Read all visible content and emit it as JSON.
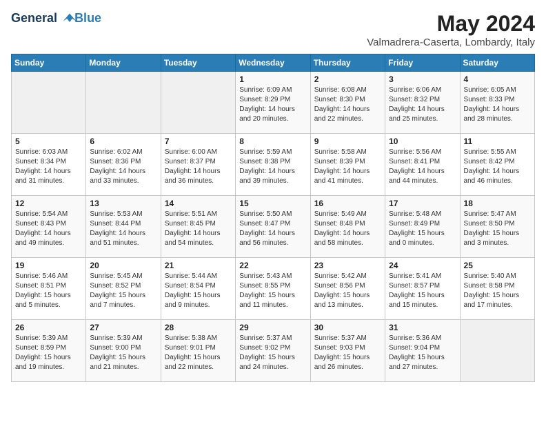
{
  "logo": {
    "line1": "General",
    "line2": "Blue"
  },
  "title": {
    "month_year": "May 2024",
    "location": "Valmadrera-Caserta, Lombardy, Italy"
  },
  "days_of_week": [
    "Sunday",
    "Monday",
    "Tuesday",
    "Wednesday",
    "Thursday",
    "Friday",
    "Saturday"
  ],
  "weeks": [
    [
      {
        "day": "",
        "empty": true
      },
      {
        "day": "",
        "empty": true
      },
      {
        "day": "",
        "empty": true
      },
      {
        "day": "1",
        "sunrise": "6:09 AM",
        "sunset": "8:29 PM",
        "daylight": "14 hours and 20 minutes."
      },
      {
        "day": "2",
        "sunrise": "6:08 AM",
        "sunset": "8:30 PM",
        "daylight": "14 hours and 22 minutes."
      },
      {
        "day": "3",
        "sunrise": "6:06 AM",
        "sunset": "8:32 PM",
        "daylight": "14 hours and 25 minutes."
      },
      {
        "day": "4",
        "sunrise": "6:05 AM",
        "sunset": "8:33 PM",
        "daylight": "14 hours and 28 minutes."
      }
    ],
    [
      {
        "day": "5",
        "sunrise": "6:03 AM",
        "sunset": "8:34 PM",
        "daylight": "14 hours and 31 minutes."
      },
      {
        "day": "6",
        "sunrise": "6:02 AM",
        "sunset": "8:36 PM",
        "daylight": "14 hours and 33 minutes."
      },
      {
        "day": "7",
        "sunrise": "6:00 AM",
        "sunset": "8:37 PM",
        "daylight": "14 hours and 36 minutes."
      },
      {
        "day": "8",
        "sunrise": "5:59 AM",
        "sunset": "8:38 PM",
        "daylight": "14 hours and 39 minutes."
      },
      {
        "day": "9",
        "sunrise": "5:58 AM",
        "sunset": "8:39 PM",
        "daylight": "14 hours and 41 minutes."
      },
      {
        "day": "10",
        "sunrise": "5:56 AM",
        "sunset": "8:41 PM",
        "daylight": "14 hours and 44 minutes."
      },
      {
        "day": "11",
        "sunrise": "5:55 AM",
        "sunset": "8:42 PM",
        "daylight": "14 hours and 46 minutes."
      }
    ],
    [
      {
        "day": "12",
        "sunrise": "5:54 AM",
        "sunset": "8:43 PM",
        "daylight": "14 hours and 49 minutes."
      },
      {
        "day": "13",
        "sunrise": "5:53 AM",
        "sunset": "8:44 PM",
        "daylight": "14 hours and 51 minutes."
      },
      {
        "day": "14",
        "sunrise": "5:51 AM",
        "sunset": "8:45 PM",
        "daylight": "14 hours and 54 minutes."
      },
      {
        "day": "15",
        "sunrise": "5:50 AM",
        "sunset": "8:47 PM",
        "daylight": "14 hours and 56 minutes."
      },
      {
        "day": "16",
        "sunrise": "5:49 AM",
        "sunset": "8:48 PM",
        "daylight": "14 hours and 58 minutes."
      },
      {
        "day": "17",
        "sunrise": "5:48 AM",
        "sunset": "8:49 PM",
        "daylight": "15 hours and 0 minutes."
      },
      {
        "day": "18",
        "sunrise": "5:47 AM",
        "sunset": "8:50 PM",
        "daylight": "15 hours and 3 minutes."
      }
    ],
    [
      {
        "day": "19",
        "sunrise": "5:46 AM",
        "sunset": "8:51 PM",
        "daylight": "15 hours and 5 minutes."
      },
      {
        "day": "20",
        "sunrise": "5:45 AM",
        "sunset": "8:52 PM",
        "daylight": "15 hours and 7 minutes."
      },
      {
        "day": "21",
        "sunrise": "5:44 AM",
        "sunset": "8:54 PM",
        "daylight": "15 hours and 9 minutes."
      },
      {
        "day": "22",
        "sunrise": "5:43 AM",
        "sunset": "8:55 PM",
        "daylight": "15 hours and 11 minutes."
      },
      {
        "day": "23",
        "sunrise": "5:42 AM",
        "sunset": "8:56 PM",
        "daylight": "15 hours and 13 minutes."
      },
      {
        "day": "24",
        "sunrise": "5:41 AM",
        "sunset": "8:57 PM",
        "daylight": "15 hours and 15 minutes."
      },
      {
        "day": "25",
        "sunrise": "5:40 AM",
        "sunset": "8:58 PM",
        "daylight": "15 hours and 17 minutes."
      }
    ],
    [
      {
        "day": "26",
        "sunrise": "5:39 AM",
        "sunset": "8:59 PM",
        "daylight": "15 hours and 19 minutes."
      },
      {
        "day": "27",
        "sunrise": "5:39 AM",
        "sunset": "9:00 PM",
        "daylight": "15 hours and 21 minutes."
      },
      {
        "day": "28",
        "sunrise": "5:38 AM",
        "sunset": "9:01 PM",
        "daylight": "15 hours and 22 minutes."
      },
      {
        "day": "29",
        "sunrise": "5:37 AM",
        "sunset": "9:02 PM",
        "daylight": "15 hours and 24 minutes."
      },
      {
        "day": "30",
        "sunrise": "5:37 AM",
        "sunset": "9:03 PM",
        "daylight": "15 hours and 26 minutes."
      },
      {
        "day": "31",
        "sunrise": "5:36 AM",
        "sunset": "9:04 PM",
        "daylight": "15 hours and 27 minutes."
      },
      {
        "day": "",
        "empty": true
      }
    ]
  ]
}
